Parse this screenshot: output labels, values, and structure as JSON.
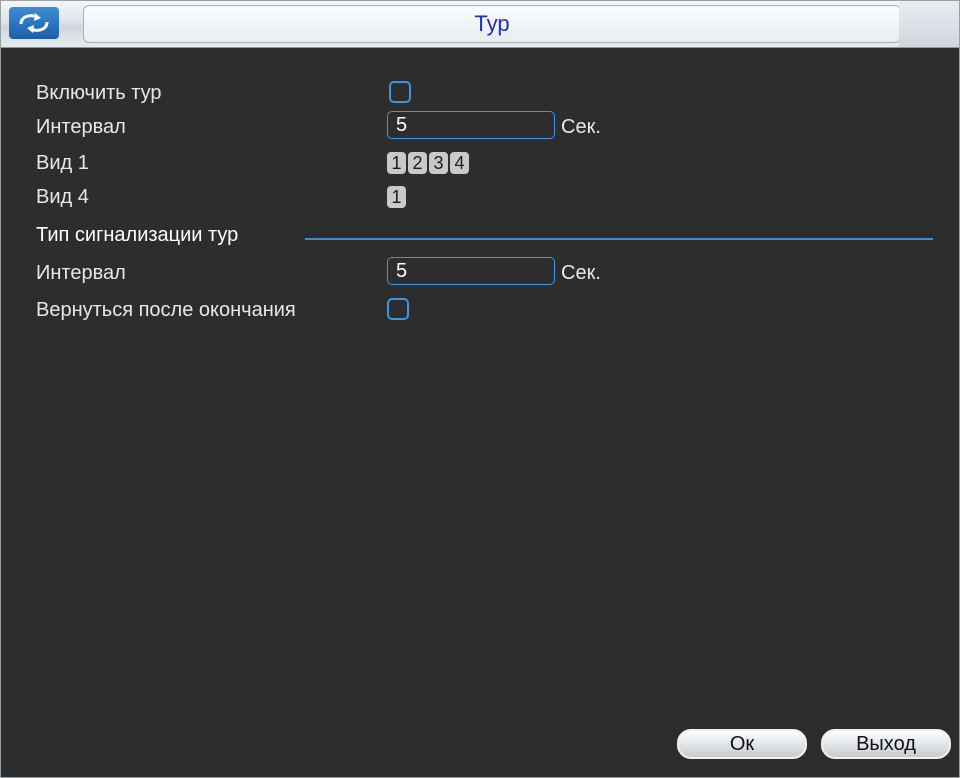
{
  "window": {
    "title": "Тур"
  },
  "tour": {
    "enable_label": "Включить тур",
    "enable_checked": false,
    "interval_label": "Интервал",
    "interval_value": "5",
    "interval_unit": "Сек.",
    "view1_label": "Вид 1",
    "view1_channels": [
      "1",
      "2",
      "3",
      "4"
    ],
    "view4_label": "Вид 4",
    "view4_channels": [
      "1"
    ]
  },
  "alarm_tour": {
    "section_label": "Тип сигнализации тур",
    "interval_label": "Интервал",
    "interval_value": "5",
    "interval_unit": "Сек.",
    "return_label": "Вернуться после окончания",
    "return_checked": false
  },
  "buttons": {
    "ok": "Ок",
    "exit": "Выход"
  },
  "icons": {
    "title": "refresh-arrows-icon"
  },
  "colors": {
    "accent": "#3a96e6",
    "background": "#2d2d2d",
    "title_text": "#1b2fc7"
  }
}
